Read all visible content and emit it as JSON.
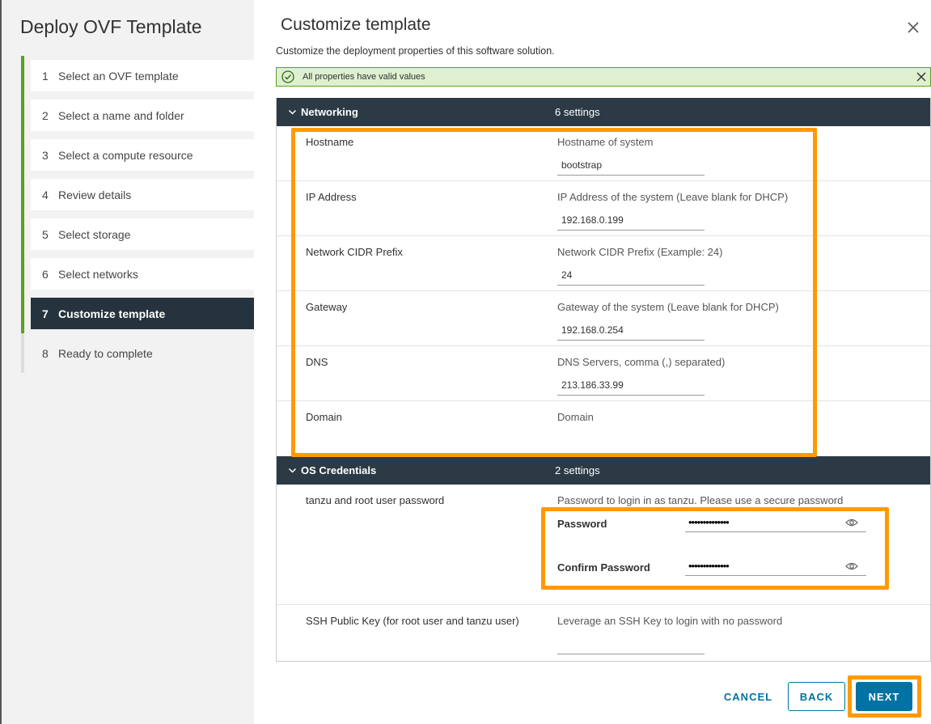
{
  "wizard": {
    "title": "Deploy OVF Template",
    "steps": [
      {
        "num": "1",
        "label": "Select an OVF template"
      },
      {
        "num": "2",
        "label": "Select a name and folder"
      },
      {
        "num": "3",
        "label": "Select a compute resource"
      },
      {
        "num": "4",
        "label": "Review details"
      },
      {
        "num": "5",
        "label": "Select storage"
      },
      {
        "num": "6",
        "label": "Select networks"
      },
      {
        "num": "7",
        "label": "Customize template"
      },
      {
        "num": "8",
        "label": "Ready to complete"
      }
    ],
    "active_step": 7
  },
  "page": {
    "title": "Customize template",
    "subtitle": "Customize the deployment properties of this software solution."
  },
  "alert": {
    "text": "All properties have valid values",
    "status": "success",
    "icon": "check-circle-icon"
  },
  "networking": {
    "name": "Networking",
    "count": "6 settings",
    "rows": [
      {
        "label": "Hostname",
        "desc": "Hostname of system",
        "value": "bootstrap"
      },
      {
        "label": "IP Address",
        "desc": "IP Address of the system (Leave blank for DHCP)",
        "value": "192.168.0.199"
      },
      {
        "label": "Network CIDR Prefix",
        "desc": "Network CIDR Prefix (Example: 24)",
        "value": "24"
      },
      {
        "label": "Gateway",
        "desc": "Gateway of the system (Leave blank for DHCP)",
        "value": "192.168.0.254"
      },
      {
        "label": "DNS",
        "desc": "DNS Servers, comma (,) separated)",
        "value": "213.186.33.99"
      },
      {
        "label": "Domain",
        "desc": "Domain",
        "value": ""
      }
    ]
  },
  "os_credentials": {
    "name": "OS Credentials",
    "count": "2 settings",
    "password_row": {
      "label": "tanzu and root user password",
      "desc": "Password to login in as tanzu. Please use a secure password",
      "password_label": "Password",
      "password_value": "••••••••••••••",
      "confirm_label": "Confirm Password",
      "confirm_value": "••••••••••••••"
    },
    "ssh_row": {
      "label": "SSH Public Key (for root user and tanzu user)",
      "desc": "Leverage an SSH Key to login with no password",
      "value": ""
    }
  },
  "buttons": {
    "cancel": "CANCEL",
    "back": "BACK",
    "next": "NEXT"
  },
  "colors": {
    "accent": "#0072a3",
    "success": "#5aa220",
    "header_bg": "#2b3a45",
    "highlight": "#ff9a00"
  }
}
